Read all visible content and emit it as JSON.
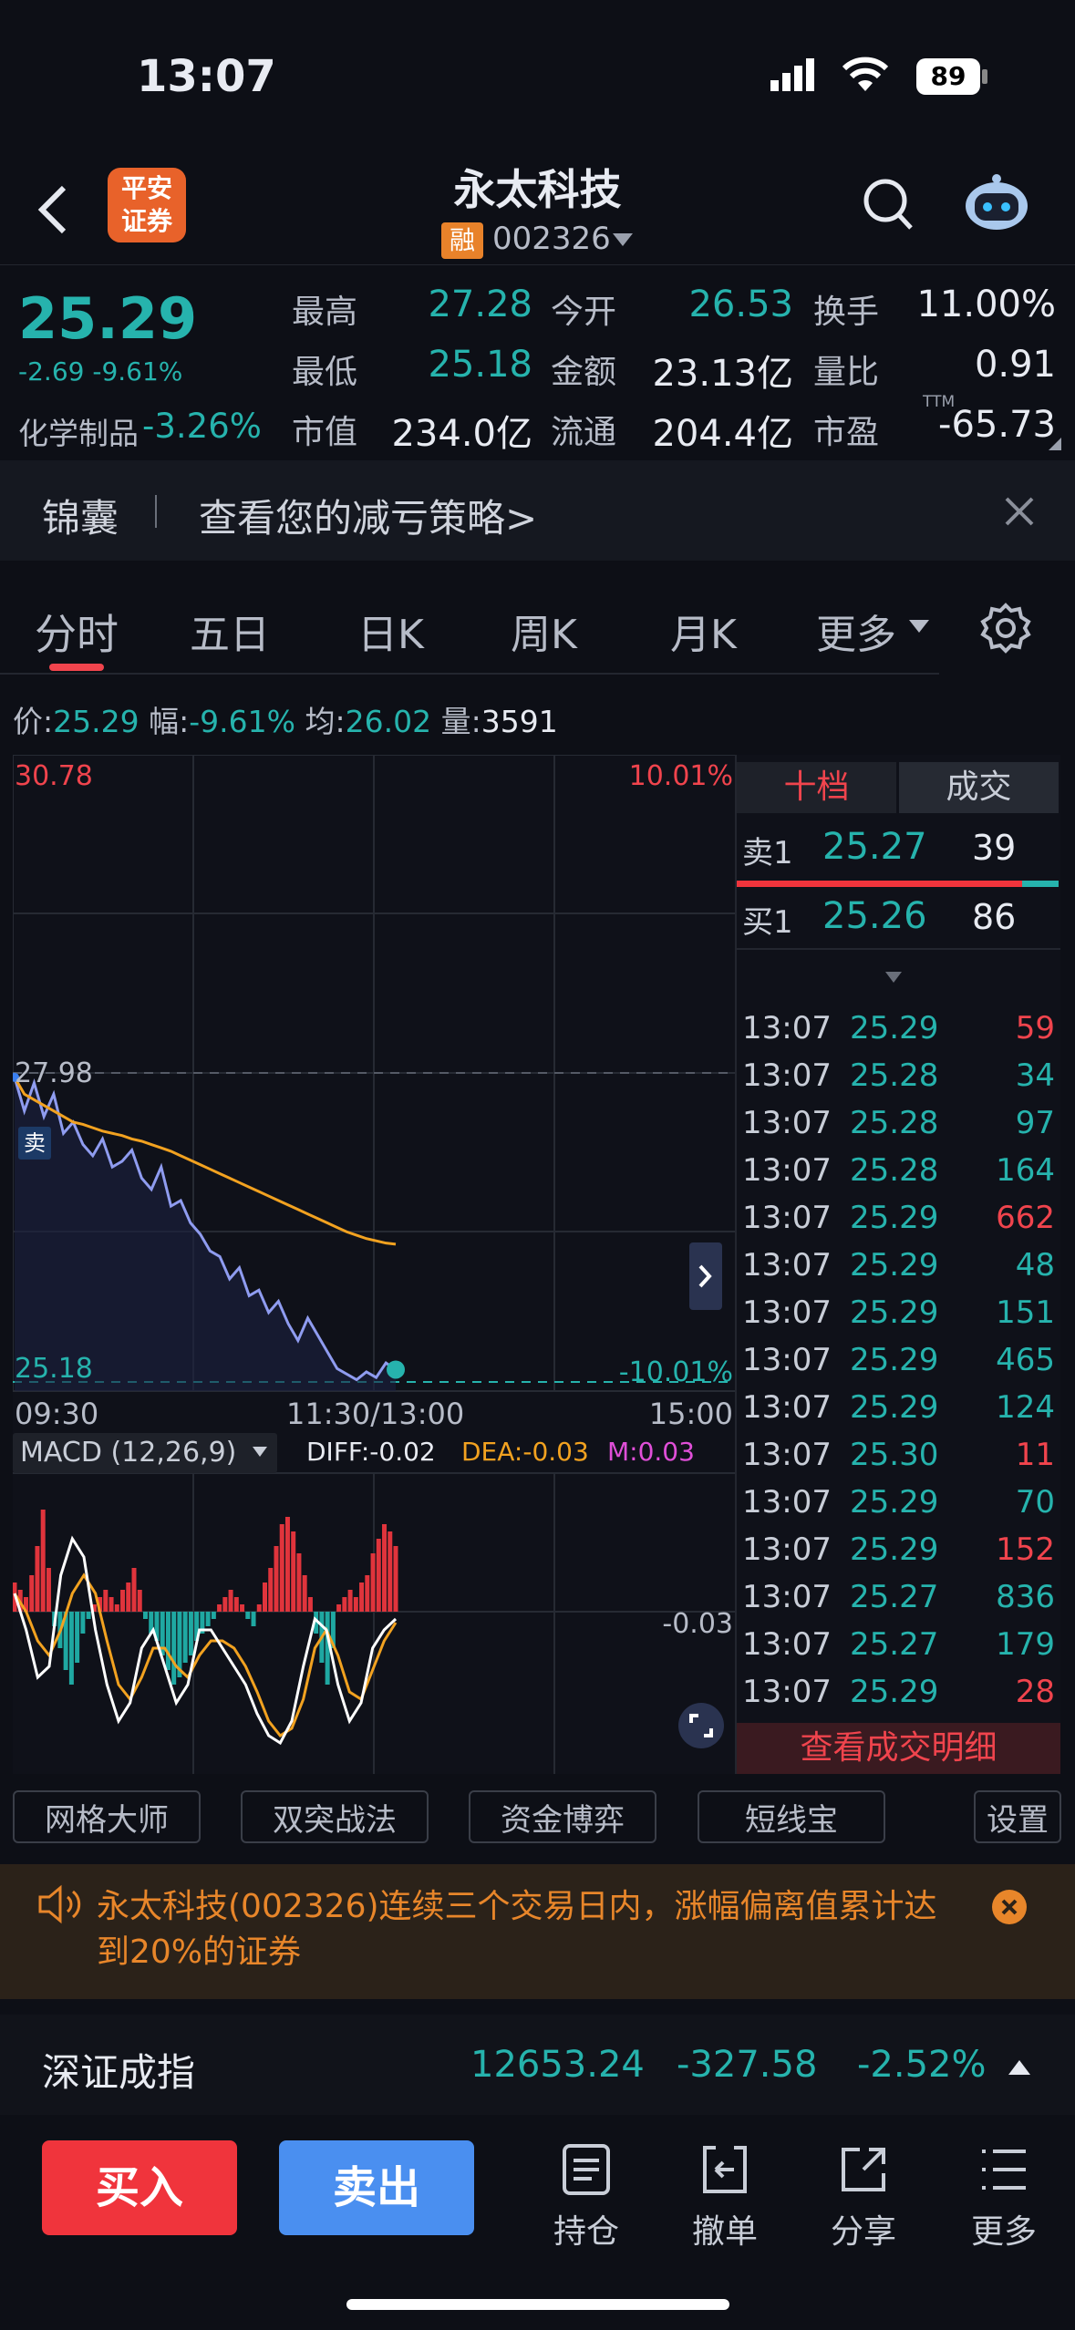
{
  "status_bar": {
    "time": "13:07",
    "battery": "89"
  },
  "header": {
    "logo_text": "平安\n证券",
    "title": "永太科技",
    "margin_badge": "融",
    "code": "002326"
  },
  "quote": {
    "price": "25.29",
    "change": "-2.69",
    "change_pct": "-9.61%",
    "sector_name": "化学制品",
    "sector_pct": "-3.26%",
    "stats": [
      {
        "label": "最高",
        "value": "27.28",
        "color": "teal"
      },
      {
        "label": "今开",
        "value": "26.53",
        "color": "teal"
      },
      {
        "label": "换手",
        "value": "11.00%",
        "color": "wht"
      },
      {
        "label": "最低",
        "value": "25.18",
        "color": "teal"
      },
      {
        "label": "金额",
        "value": "23.13亿",
        "color": "wht"
      },
      {
        "label": "量比",
        "value": "0.91",
        "color": "wht"
      },
      {
        "label": "市值",
        "value": "234.0亿",
        "color": "wht"
      },
      {
        "label": "流通",
        "value": "204.4亿",
        "color": "wht"
      },
      {
        "label": "市盈",
        "value": "-65.73",
        "color": "wht"
      }
    ],
    "ttm_label": "TTM"
  },
  "banner": {
    "label": "锦囊",
    "text": "查看您的减亏策略>"
  },
  "tabs": [
    "分时",
    "五日",
    "日K",
    "周K",
    "月K",
    "更多"
  ],
  "info_line": {
    "price_label": "价:",
    "price": "25.29",
    "amp_label": "幅:",
    "amp": "-9.61%",
    "avg_label": "均:",
    "avg": "26.02",
    "vol_label": "量:",
    "vol": "3591"
  },
  "chart_data": {
    "type": "line",
    "title": "",
    "y_labels": {
      "top": "30.78",
      "mid": "27.98",
      "bottom": "25.18",
      "top_pct": "10.01%",
      "bottom_pct": "-10.01%"
    },
    "x_labels": [
      "09:30",
      "11:30/13:00",
      "15:00"
    ],
    "ylim": [
      25.18,
      30.78
    ],
    "sell_marker": "卖",
    "series": [
      {
        "values": [
          27.9,
          27.6,
          27.85,
          27.55,
          27.75,
          27.4,
          27.5,
          27.3,
          27.2,
          27.35,
          27.1,
          27.15,
          27.25,
          27.0,
          26.9,
          27.1,
          26.75,
          26.8,
          26.6,
          26.5,
          26.35,
          26.3,
          26.1,
          26.2,
          25.95,
          26.0,
          25.8,
          25.9,
          25.7,
          25.55,
          25.75,
          25.6,
          25.45,
          25.3,
          25.25,
          25.2,
          25.27,
          25.22,
          25.35,
          25.29
        ]
      },
      {
        "values": [
          27.9,
          27.75,
          27.7,
          27.65,
          27.6,
          27.55,
          27.5,
          27.48,
          27.45,
          27.42,
          27.4,
          27.38,
          27.35,
          27.33,
          27.3,
          27.27,
          27.24,
          27.2,
          27.16,
          27.12,
          27.08,
          27.04,
          27.0,
          26.96,
          26.92,
          26.88,
          26.84,
          26.8,
          26.76,
          26.72,
          26.68,
          26.64,
          26.6,
          26.56,
          26.52,
          26.49,
          26.46,
          26.44,
          26.42,
          26.41
        ]
      }
    ],
    "macd": {
      "label": "MACD (12,26,9)",
      "diff_label": "DIFF:-0.02",
      "dea_label": "DEA:-0.03",
      "m_label": "M:0.03",
      "level_label": "-0.03",
      "bars": [
        0.04,
        0.03,
        0.02,
        0.05,
        0.09,
        0.14,
        0.06,
        -0.02,
        -0.05,
        -0.08,
        -0.1,
        -0.07,
        -0.03,
        -0.01,
        0.01,
        0.02,
        0.03,
        0.02,
        0.01,
        0.03,
        0.04,
        0.06,
        0.03,
        -0.01,
        -0.03,
        -0.04,
        -0.06,
        -0.08,
        -0.1,
        -0.09,
        -0.07,
        -0.06,
        -0.04,
        -0.03,
        -0.02,
        -0.01,
        0.01,
        0.02,
        0.03,
        0.02,
        0.01,
        -0.01,
        -0.02,
        0.01,
        0.04,
        0.06,
        0.09,
        0.12,
        0.13,
        0.11,
        0.08,
        0.05,
        0.02,
        -0.03,
        -0.07,
        -0.1,
        -0.05,
        0.01,
        0.02,
        0.03,
        0.02,
        0.04,
        0.05,
        0.08,
        0.1,
        0.12,
        0.11,
        0.09
      ],
      "diff": [
        0.05,
        -0.05,
        -0.18,
        -0.15,
        0.1,
        0.2,
        0.15,
        -0.05,
        -0.2,
        -0.3,
        -0.25,
        -0.1,
        -0.05,
        -0.15,
        -0.25,
        -0.2,
        -0.05,
        -0.05,
        -0.1,
        -0.15,
        -0.2,
        -0.28,
        -0.34,
        -0.36,
        -0.3,
        -0.15,
        -0.02,
        -0.05,
        -0.2,
        -0.3,
        -0.25,
        -0.1,
        -0.05,
        -0.02
      ],
      "dea": [
        0.05,
        0.0,
        -0.08,
        -0.12,
        -0.05,
        0.05,
        0.1,
        0.05,
        -0.08,
        -0.2,
        -0.24,
        -0.18,
        -0.1,
        -0.1,
        -0.15,
        -0.18,
        -0.12,
        -0.08,
        -0.08,
        -0.1,
        -0.15,
        -0.22,
        -0.3,
        -0.34,
        -0.32,
        -0.24,
        -0.1,
        -0.05,
        -0.12,
        -0.22,
        -0.24,
        -0.16,
        -0.08,
        -0.03
      ]
    }
  },
  "side_panel": {
    "tab_active": "十档",
    "tab_other": "成交",
    "ask": {
      "label": "卖1",
      "price": "25.27",
      "vol": "39"
    },
    "bid": {
      "label": "买1",
      "price": "25.26",
      "vol": "86"
    },
    "ticks": [
      {
        "time": "13:07",
        "price": "25.29",
        "vol": "59",
        "vc": "red"
      },
      {
        "time": "13:07",
        "price": "25.28",
        "vol": "34",
        "vc": "teal"
      },
      {
        "time": "13:07",
        "price": "25.28",
        "vol": "97",
        "vc": "teal"
      },
      {
        "time": "13:07",
        "price": "25.28",
        "vol": "164",
        "vc": "teal"
      },
      {
        "time": "13:07",
        "price": "25.29",
        "vol": "662",
        "vc": "red"
      },
      {
        "time": "13:07",
        "price": "25.29",
        "vol": "48",
        "vc": "teal"
      },
      {
        "time": "13:07",
        "price": "25.29",
        "vol": "151",
        "vc": "teal"
      },
      {
        "time": "13:07",
        "price": "25.29",
        "vol": "465",
        "vc": "teal"
      },
      {
        "time": "13:07",
        "price": "25.29",
        "vol": "124",
        "vc": "teal"
      },
      {
        "time": "13:07",
        "price": "25.30",
        "vol": "11",
        "vc": "red"
      },
      {
        "time": "13:07",
        "price": "25.29",
        "vol": "70",
        "vc": "teal"
      },
      {
        "time": "13:07",
        "price": "25.29",
        "vol": "152",
        "vc": "red"
      },
      {
        "time": "13:07",
        "price": "25.27",
        "vol": "836",
        "vc": "teal"
      },
      {
        "time": "13:07",
        "price": "25.27",
        "vol": "179",
        "vc": "teal"
      },
      {
        "time": "13:07",
        "price": "25.29",
        "vol": "28",
        "vc": "red"
      }
    ],
    "detail_link": "查看成交明细"
  },
  "tools": [
    "网格大师",
    "双突战法",
    "资金博弈",
    "短线宝",
    "设置"
  ],
  "notice": {
    "text": "永太科技(002326)连续三个交易日内，涨幅偏离值累计达到20%的证券"
  },
  "index_bar": {
    "name": "深证成指",
    "value": "12653.24",
    "change": "-327.58",
    "pct": "-2.52%"
  },
  "bottom_nav": {
    "buy": "买入",
    "sell": "卖出",
    "items": [
      "持仓",
      "撤单",
      "分享",
      "更多"
    ]
  },
  "colors": {
    "bg": "#0d0f16",
    "up": "#f0444d",
    "down": "#26b3ad",
    "buy": "#f0343c",
    "sell": "#4a8ff0",
    "price_line": "#8f9cf0",
    "avg_line": "#f2a220"
  }
}
